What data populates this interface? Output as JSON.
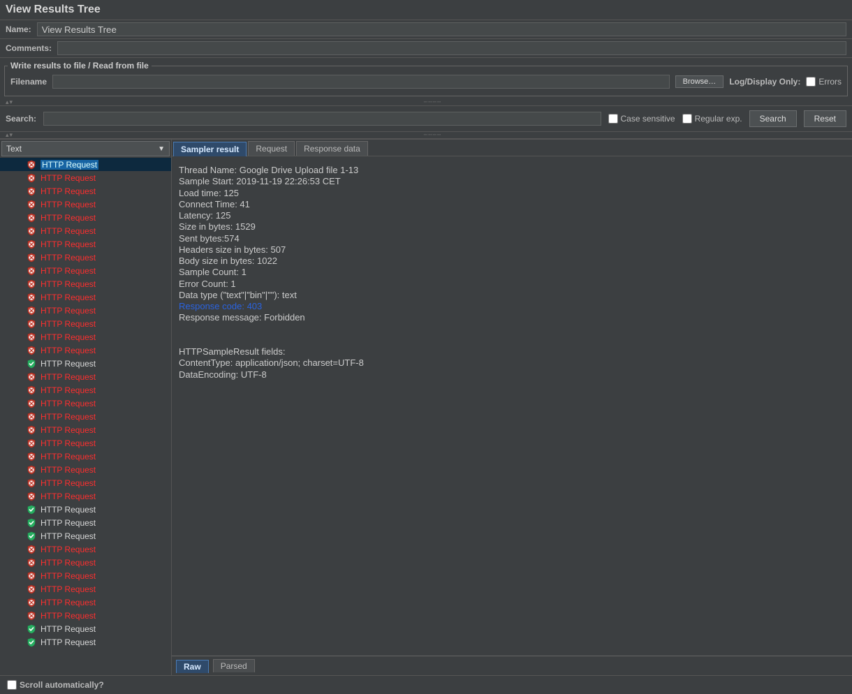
{
  "title": "View Results Tree",
  "name_label": "Name:",
  "name_value": "View Results Tree",
  "comments_label": "Comments:",
  "fieldset_legend": "Write results to file / Read from file",
  "filename_label": "Filename",
  "browse_btn": "Browse…",
  "log_display_only_label": "Log/Display Only:",
  "errors_label": "Errors",
  "search_label": "Search:",
  "case_sensitive_label": "Case sensitive",
  "regex_label": "Regular exp.",
  "search_btn": "Search",
  "reset_btn": "Reset",
  "renderer_dropdown": "Text",
  "tabs": {
    "sampler": "Sampler result",
    "request": "Request",
    "response": "Response data"
  },
  "bottom_tabs": {
    "raw": "Raw",
    "parsed": "Parsed"
  },
  "scroll_auto_label": "Scroll automatically?",
  "detail_lines": [
    "Thread Name: Google Drive Upload file 1-13",
    "Sample Start: 2019-11-19 22:26:53 CET",
    "Load time: 125",
    "Connect Time: 41",
    "Latency: 125",
    "Size in bytes: 1529",
    "Sent bytes:574",
    "Headers size in bytes: 507",
    "Body size in bytes: 1022",
    "Sample Count: 1",
    "Error Count: 1",
    "Data type (\"text\"|\"bin\"|\"\"): text"
  ],
  "detail_highlight": "Response code: 403",
  "detail_lines2": [
    "Response message: Forbidden",
    "",
    "",
    "HTTPSampleResult fields:",
    "ContentType: application/json; charset=UTF-8",
    "DataEncoding: UTF-8"
  ],
  "tree": [
    {
      "label": "HTTP Request",
      "status": "err",
      "selected": true
    },
    {
      "label": "HTTP Request",
      "status": "err"
    },
    {
      "label": "HTTP Request",
      "status": "err"
    },
    {
      "label": "HTTP Request",
      "status": "err"
    },
    {
      "label": "HTTP Request",
      "status": "err"
    },
    {
      "label": "HTTP Request",
      "status": "err"
    },
    {
      "label": "HTTP Request",
      "status": "err"
    },
    {
      "label": "HTTP Request",
      "status": "err"
    },
    {
      "label": "HTTP Request",
      "status": "err"
    },
    {
      "label": "HTTP Request",
      "status": "err"
    },
    {
      "label": "HTTP Request",
      "status": "err"
    },
    {
      "label": "HTTP Request",
      "status": "err"
    },
    {
      "label": "HTTP Request",
      "status": "err"
    },
    {
      "label": "HTTP Request",
      "status": "err"
    },
    {
      "label": "HTTP Request",
      "status": "err"
    },
    {
      "label": "HTTP Request",
      "status": "ok"
    },
    {
      "label": "HTTP Request",
      "status": "err"
    },
    {
      "label": "HTTP Request",
      "status": "err"
    },
    {
      "label": "HTTP Request",
      "status": "err"
    },
    {
      "label": "HTTP Request",
      "status": "err"
    },
    {
      "label": "HTTP Request",
      "status": "err"
    },
    {
      "label": "HTTP Request",
      "status": "err"
    },
    {
      "label": "HTTP Request",
      "status": "err"
    },
    {
      "label": "HTTP Request",
      "status": "err"
    },
    {
      "label": "HTTP Request",
      "status": "err"
    },
    {
      "label": "HTTP Request",
      "status": "err"
    },
    {
      "label": "HTTP Request",
      "status": "ok"
    },
    {
      "label": "HTTP Request",
      "status": "ok"
    },
    {
      "label": "HTTP Request",
      "status": "ok"
    },
    {
      "label": "HTTP Request",
      "status": "err"
    },
    {
      "label": "HTTP Request",
      "status": "err"
    },
    {
      "label": "HTTP Request",
      "status": "err"
    },
    {
      "label": "HTTP Request",
      "status": "err"
    },
    {
      "label": "HTTP Request",
      "status": "err"
    },
    {
      "label": "HTTP Request",
      "status": "err"
    },
    {
      "label": "HTTP Request",
      "status": "ok"
    },
    {
      "label": "HTTP Request",
      "status": "ok"
    }
  ]
}
